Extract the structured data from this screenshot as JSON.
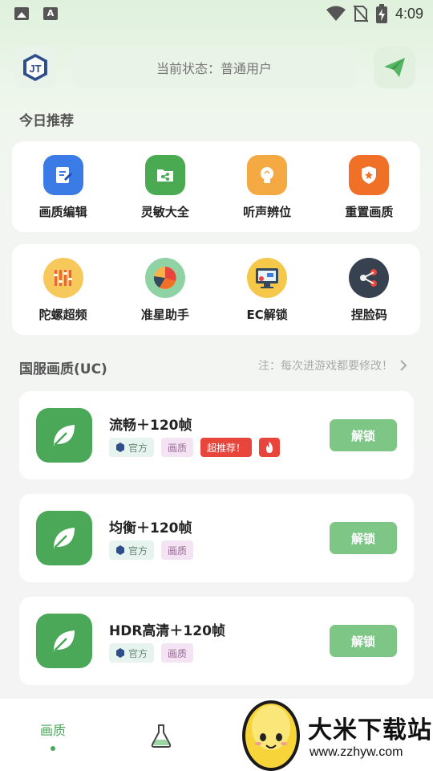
{
  "statusbar": {
    "time": "4:09",
    "icons": [
      "image-icon",
      "a-icon",
      "wifi-icon",
      "no-sim-icon",
      "battery-charging-icon"
    ]
  },
  "header": {
    "status_text": "当前状态：普通用户",
    "logo_text": "JT",
    "send_icon": "send-icon"
  },
  "today": {
    "title": "今日推荐",
    "row1": [
      {
        "label": "画质编辑",
        "color": "#3b7be6",
        "icon": "edit-doc-icon"
      },
      {
        "label": "灵敏大全",
        "color": "#4aaa52",
        "icon": "share-folder-icon"
      },
      {
        "label": "听声辨位",
        "color": "#f5a943",
        "icon": "bulb-icon"
      },
      {
        "label": "重置画质",
        "color": "#f07028",
        "icon": "shield-star-icon"
      }
    ],
    "row2": [
      {
        "label": "陀螺超频",
        "color": "#f7c85a",
        "icon": "sliders-icon"
      },
      {
        "label": "准星助手",
        "color": "#8fd3a4",
        "icon": "pie-chart-icon"
      },
      {
        "label": "EC解锁",
        "color": "#f5c84a",
        "icon": "monitor-icon"
      },
      {
        "label": "捏脸码",
        "color": "#37414f",
        "icon": "share-icon"
      }
    ]
  },
  "cn_quality": {
    "title": "国服画质(UC)",
    "note": "注：每次进游戏都要修改！",
    "items": [
      {
        "title": "流畅＋120帧",
        "tag_official": "官方",
        "tag_quality": "画质",
        "tag_recommend": "超推荐！",
        "button": "解锁"
      },
      {
        "title": "均衡＋120帧",
        "tag_official": "官方",
        "tag_quality": "画质",
        "button": "解锁"
      },
      {
        "title": "HDR高清＋120帧",
        "tag_official": "官方",
        "tag_quality": "画质",
        "button": "解锁"
      }
    ]
  },
  "bottom_nav": {
    "tab1": "画质"
  },
  "watermark": {
    "name": "大米下载站",
    "url": "www.zzhyw.com"
  },
  "colors": {
    "accent": "#4aa858",
    "unlock_button": "#7dc685",
    "recommend_tag": "#e8463d"
  }
}
